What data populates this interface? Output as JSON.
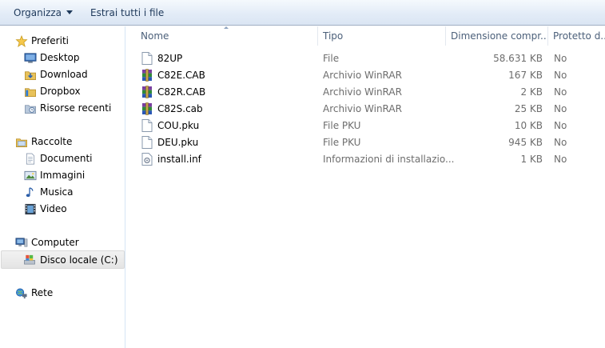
{
  "toolbar": {
    "organize_label": "Organizza",
    "extract_label": "Estrai tutti i file"
  },
  "nav": {
    "favorites": "Preferiti",
    "desktop": "Desktop",
    "download": "Download",
    "dropbox": "Dropbox",
    "recent": "Risorse recenti",
    "libraries": "Raccolte",
    "documents": "Documenti",
    "pictures": "Immagini",
    "music": "Musica",
    "videos": "Video",
    "computer": "Computer",
    "local_disk": "Disco locale (C:)",
    "network": "Rete"
  },
  "columns": {
    "name": "Nome",
    "type": "Tipo",
    "size": "Dimensione compr...",
    "protected": "Protetto d..."
  },
  "files": [
    {
      "name": "82UP",
      "type": "File",
      "size": "58.631 KB",
      "protected": "No",
      "icon": "blank-file-icon"
    },
    {
      "name": "C82E.CAB",
      "type": "Archivio WinRAR",
      "size": "167 KB",
      "protected": "No",
      "icon": "winrar-archive-icon"
    },
    {
      "name": "C82R.CAB",
      "type": "Archivio WinRAR",
      "size": "2 KB",
      "protected": "No",
      "icon": "winrar-archive-icon"
    },
    {
      "name": "C82S.cab",
      "type": "Archivio WinRAR",
      "size": "25 KB",
      "protected": "No",
      "icon": "winrar-archive-icon"
    },
    {
      "name": "COU.pku",
      "type": "File PKU",
      "size": "10 KB",
      "protected": "No",
      "icon": "blank-file-icon"
    },
    {
      "name": "DEU.pku",
      "type": "File PKU",
      "size": "945 KB",
      "protected": "No",
      "icon": "blank-file-icon"
    },
    {
      "name": "install.inf",
      "type": "Informazioni di installazio...",
      "size": "1 KB",
      "protected": "No",
      "icon": "setup-info-file-icon"
    }
  ]
}
